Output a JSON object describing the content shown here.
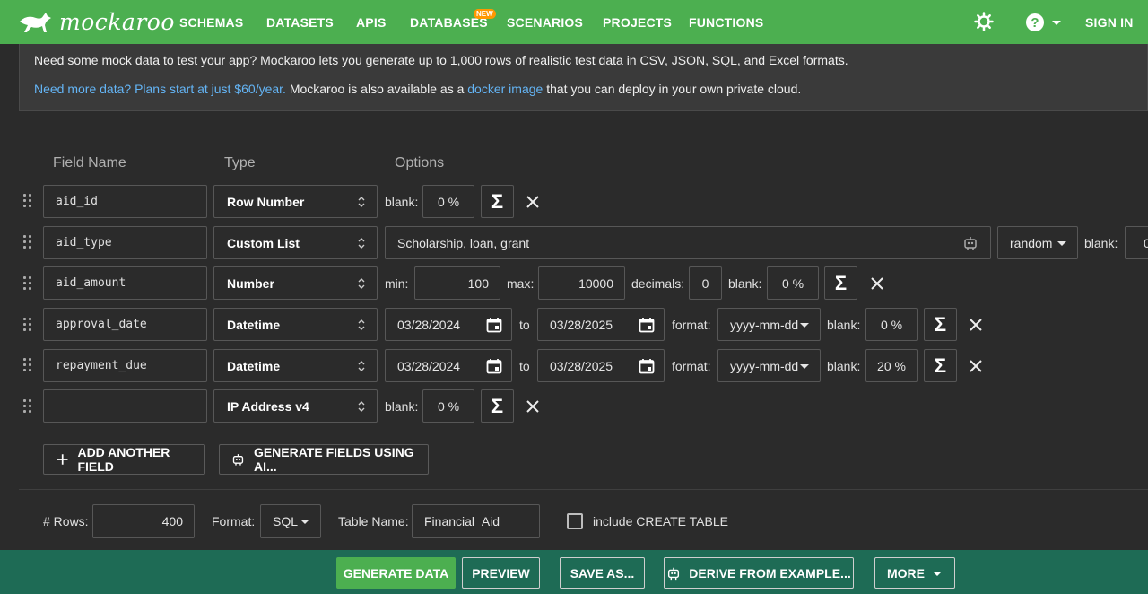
{
  "nav": {
    "logo_text": "mockaroo",
    "items": [
      "SCHEMAS",
      "DATASETS",
      "APIS",
      "DATABASES",
      "SCENARIOS",
      "PROJECTS",
      "FUNCTIONS"
    ],
    "new_badge": "NEW",
    "sign_in": "SIGN IN"
  },
  "banner": {
    "line1": "Need some mock data to test your app? Mockaroo lets you generate up to 1,000 rows of realistic test data in CSV, JSON, SQL, and Excel formats.",
    "link1": "Need more data? Plans start at just $60/year.",
    "text2": " Mockaroo is also available as a ",
    "link2": "docker image",
    "text3": " that you can deploy in your own private cloud."
  },
  "columns": {
    "field_name": "Field Name",
    "type": "Type",
    "options": "Options"
  },
  "fields": [
    {
      "name": "aid_id",
      "type": "Row Number",
      "blank_label": "blank:",
      "blank": "0 %"
    },
    {
      "name": "aid_type",
      "type": "Custom List",
      "values": "Scholarship, loan, grant",
      "order": "random",
      "blank_label": "blank:",
      "blank": "0"
    },
    {
      "name": "aid_amount",
      "type": "Number",
      "min_label": "min:",
      "min": "100",
      "max_label": "max:",
      "max": "10000",
      "decimals_label": "decimals:",
      "decimals": "0",
      "blank_label": "blank:",
      "blank": "0 %"
    },
    {
      "name": "approval_date",
      "type": "Datetime",
      "from": "03/28/2024",
      "to_label": "to",
      "to": "03/28/2025",
      "format_label": "format:",
      "format": "yyyy-mm-dd",
      "blank_label": "blank:",
      "blank": "0 %"
    },
    {
      "name": "repayment_due",
      "type": "Datetime",
      "from": "03/28/2024",
      "to_label": "to",
      "to": "03/28/2025",
      "format_label": "format:",
      "format": "yyyy-mm-dd",
      "blank_label": "blank:",
      "blank": "20 %"
    },
    {
      "name": "",
      "type": "IP Address v4",
      "blank_label": "blank:",
      "blank": "0 %"
    }
  ],
  "sigma": "Σ",
  "actions": {
    "add_field": "ADD ANOTHER FIELD",
    "generate_ai": "GENERATE FIELDS USING AI..."
  },
  "options": {
    "rows_label": "# Rows:",
    "rows": "400",
    "format_label": "Format:",
    "format": "SQL",
    "table_label": "Table Name:",
    "table": "Financial_Aid",
    "create_table": "include CREATE TABLE"
  },
  "footer": {
    "generate": "GENERATE DATA",
    "preview": "PREVIEW",
    "save_as": "SAVE AS...",
    "derive": "DERIVE FROM EXAMPLE...",
    "more": "MORE"
  },
  "colors": {
    "brand_green": "#4caf50",
    "footer_teal": "#1e6b55",
    "link_blue": "#64b5f6",
    "badge_orange": "#ff9800"
  }
}
